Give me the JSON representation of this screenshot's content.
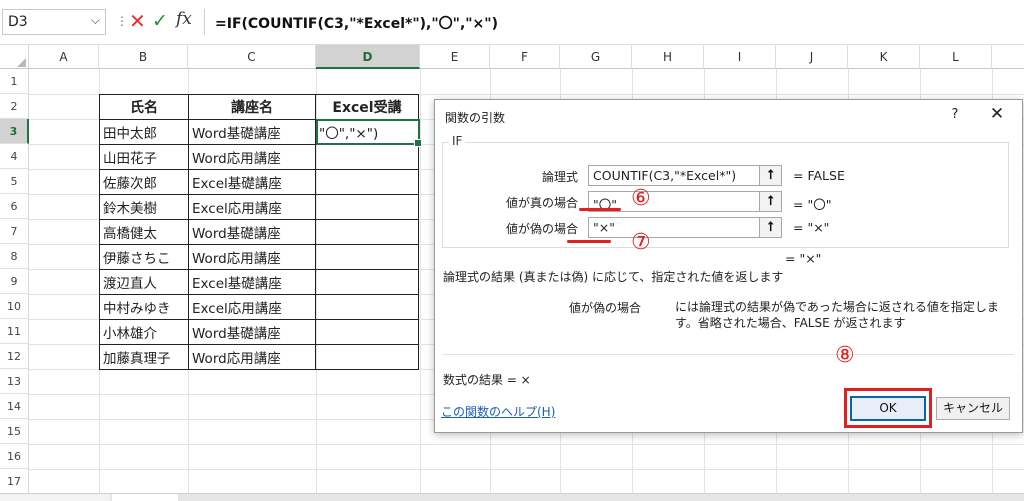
{
  "formula_bar": {
    "name_box": "D3",
    "formula": "=IF(COUNTIF(C3,\"*Excel*\"),\"〇\",\"×\")"
  },
  "columns": [
    "A",
    "B",
    "C",
    "D",
    "E",
    "F",
    "G",
    "H",
    "I",
    "J",
    "K",
    "L"
  ],
  "selected_column": "D",
  "rows": [
    "1",
    "2",
    "3",
    "4",
    "5",
    "6",
    "7",
    "8",
    "9",
    "10",
    "11",
    "12",
    "13",
    "14",
    "15",
    "16",
    "17"
  ],
  "selected_row": "3",
  "table": {
    "headers": [
      "氏名",
      "講座名",
      "Excel受講"
    ],
    "rows": [
      [
        "田中太郎",
        "Word基礎講座",
        "\"〇\",\"×\")"
      ],
      [
        "山田花子",
        "Word応用講座",
        ""
      ],
      [
        "佐藤次郎",
        "Excel基礎講座",
        ""
      ],
      [
        "鈴木美樹",
        "Excel応用講座",
        ""
      ],
      [
        "高橋健太",
        "Word基礎講座",
        ""
      ],
      [
        "伊藤さちこ",
        "Word応用講座",
        ""
      ],
      [
        "渡辺直人",
        "Excel基礎講座",
        ""
      ],
      [
        "中村みゆき",
        "Excel応用講座",
        ""
      ],
      [
        "小林雄介",
        "Word基礎講座",
        ""
      ],
      [
        "加藤真理子",
        "Word応用講座",
        ""
      ]
    ]
  },
  "dialog": {
    "title": "関数の引数",
    "help_char": "?",
    "close_char": "✕",
    "function_name": "IF",
    "args": [
      {
        "label": "論理式",
        "value": "COUNTIF(C3,\"*Excel*\")",
        "result": "=  FALSE"
      },
      {
        "label": "値が真の場合",
        "value": "\"〇\"",
        "result": "=  \"〇\""
      },
      {
        "label": "値が偽の場合",
        "value": "\"×\"",
        "result": "=  \"×\""
      }
    ],
    "overall_result": "=  \"×\"",
    "description": "論理式の結果 (真または偽) に応じて、指定された値を返します",
    "arg_desc_label": "値が偽の場合",
    "arg_desc_text": "には論理式の結果が偽であった場合に返される値を指定します。省略された場合、FALSE が返されます",
    "formula_result": "数式の結果 =   ×",
    "help_link": "この関数のヘルプ(H)",
    "ok_label": "OK",
    "cancel_label": "キャンセル"
  },
  "annotations": {
    "step6": "⑥",
    "step7": "⑦",
    "step8": "⑧",
    "color": "#e02020"
  }
}
